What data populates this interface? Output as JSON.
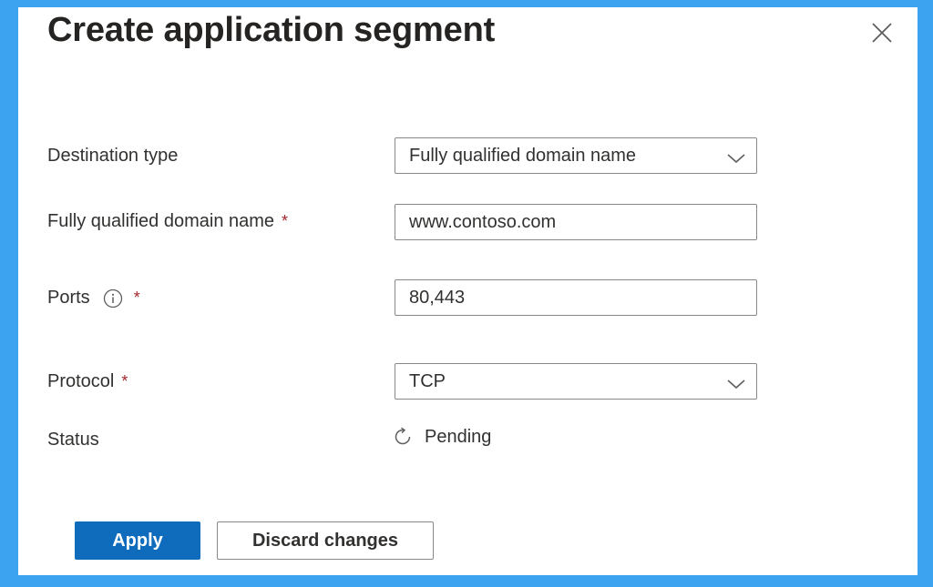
{
  "dialog": {
    "title": "Create application segment",
    "close_icon": "close-icon"
  },
  "form": {
    "destination_type": {
      "label": "Destination type",
      "value": "Fully qualified domain name",
      "icon": "chevron-down-icon"
    },
    "fqdn": {
      "label": "Fully qualified domain name",
      "required_marker": "*",
      "value": "www.contoso.com"
    },
    "ports": {
      "label": "Ports",
      "info_icon": "info-icon",
      "required_marker": "*",
      "value": "80,443"
    },
    "protocol": {
      "label": "Protocol",
      "required_marker": "*",
      "value": "TCP",
      "icon": "chevron-down-icon"
    },
    "status": {
      "label": "Status",
      "value": "Pending",
      "icon": "refresh-icon"
    }
  },
  "actions": {
    "apply_label": "Apply",
    "discard_label": "Discard changes"
  },
  "colors": {
    "frame": "#3ba3ef",
    "primary": "#0f6cbd",
    "required": "#a4262c"
  }
}
